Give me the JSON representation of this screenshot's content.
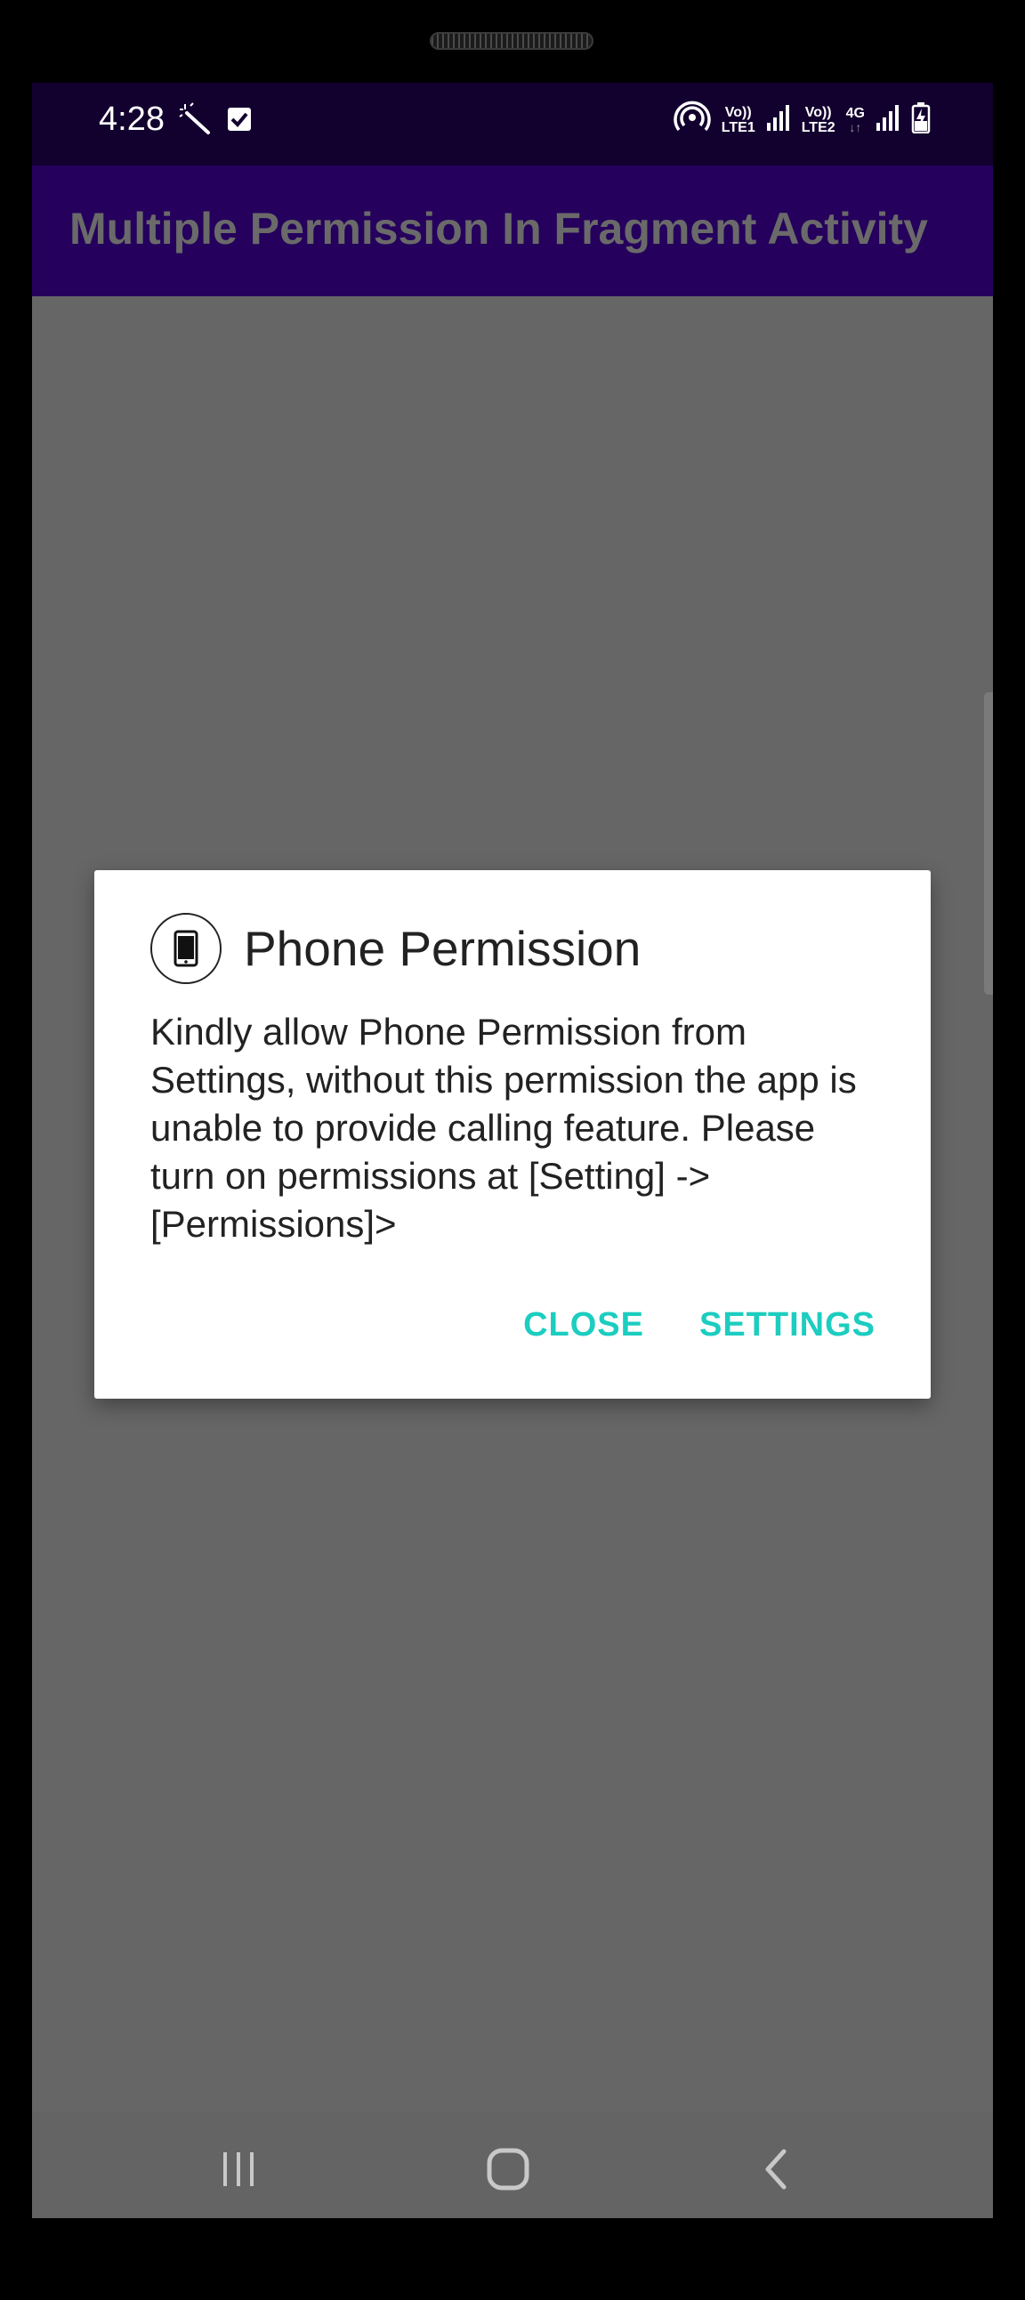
{
  "status_bar": {
    "time": "4:28",
    "left_icons": [
      "magic-wand-icon",
      "checkbox-icon"
    ],
    "right_icons": [
      "hotspot-icon",
      "volte-lte1-icon",
      "signal-icon",
      "volte-lte2-icon",
      "4g-icon",
      "signal-icon",
      "battery-charging-icon"
    ],
    "sim1_label_top": "Vo))",
    "sim1_label_bottom": "LTE1",
    "sim2_label_top": "Vo))",
    "sim2_label_bottom": "LTE2",
    "network_label": "4G"
  },
  "app_bar": {
    "title": "Multiple Permission In Fragment Activity"
  },
  "dialog": {
    "icon": "phone-icon",
    "title": "Phone Permission",
    "message": "Kindly allow Phone Permission from Settings, without this permission the app is unable to provide calling feature. Please turn on permissions at [Setting] -> [Permissions]>",
    "close_label": "CLOSE",
    "settings_label": "SETTINGS"
  },
  "nav_bar": {
    "recent_icon": "recent-apps-icon",
    "home_icon": "home-icon",
    "back_icon": "back-icon"
  },
  "colors": {
    "status_bar_bg": "#12002e",
    "app_bar_bg": "#25005c",
    "scrim": "#666666",
    "accent": "#1ccdc0"
  }
}
